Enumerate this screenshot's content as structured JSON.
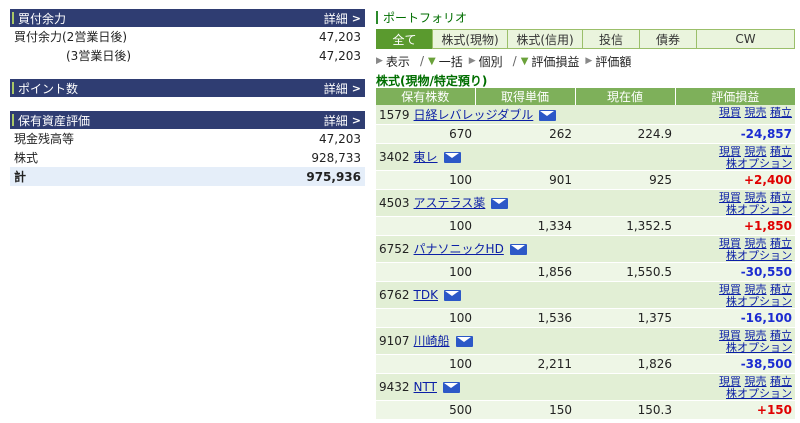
{
  "buying_power": {
    "title": "買付余力",
    "detail": "詳細",
    "rows": [
      {
        "label": "買付余力(2営業日後)",
        "value": "47,203"
      },
      {
        "label": "(3営業日後)",
        "value": "47,203"
      }
    ]
  },
  "points": {
    "title": "ポイント数",
    "detail": "詳細"
  },
  "assets": {
    "title": "保有資産評価",
    "detail": "詳細",
    "rows": [
      {
        "label": "現金残高等",
        "value": "47,203"
      },
      {
        "label": "株式",
        "value": "928,733"
      }
    ],
    "total": {
      "label": "計",
      "value": "975,936"
    }
  },
  "portfolio": {
    "title": "ポートフォリオ",
    "tabs": [
      "全て",
      "株式(現物)",
      "株式(信用)",
      "投信",
      "債券",
      "CW"
    ],
    "active_tab": 0,
    "filters": {
      "display": "表示",
      "bulk": "一括",
      "individual": "個別",
      "pl": "評価損益",
      "value": "評価額",
      "sep": "/"
    },
    "category": "株式(現物/特定預り)",
    "columns": [
      "保有株数",
      "取得単価",
      "現在値",
      "評価損益"
    ],
    "actions": {
      "buy": "現買",
      "sell": "現売",
      "accum": "積立",
      "option": "株オプション"
    },
    "holdings": [
      {
        "code": "1579",
        "name": "日経レバレッジダブル",
        "qty": "670",
        "cost": "262",
        "price": "224.9",
        "pl": "-24,857",
        "sign": "neg",
        "option": false
      },
      {
        "code": "3402",
        "name": "東レ",
        "qty": "100",
        "cost": "901",
        "price": "925",
        "pl": "+2,400",
        "sign": "pos",
        "option": true
      },
      {
        "code": "4503",
        "name": "アステラス薬",
        "qty": "100",
        "cost": "1,334",
        "price": "1,352.5",
        "pl": "+1,850",
        "sign": "pos",
        "option": true
      },
      {
        "code": "6752",
        "name": "パナソニックHD",
        "qty": "100",
        "cost": "1,856",
        "price": "1,550.5",
        "pl": "-30,550",
        "sign": "neg",
        "option": true
      },
      {
        "code": "6762",
        "name": "TDK",
        "qty": "100",
        "cost": "1,536",
        "price": "1,375",
        "pl": "-16,100",
        "sign": "neg",
        "option": true
      },
      {
        "code": "9107",
        "name": "川崎船",
        "qty": "100",
        "cost": "2,211",
        "price": "1,826",
        "pl": "-38,500",
        "sign": "neg",
        "option": true
      },
      {
        "code": "9432",
        "name": "NTT",
        "qty": "500",
        "cost": "150",
        "price": "150.3",
        "pl": "+150",
        "sign": "pos",
        "option": true
      }
    ]
  }
}
